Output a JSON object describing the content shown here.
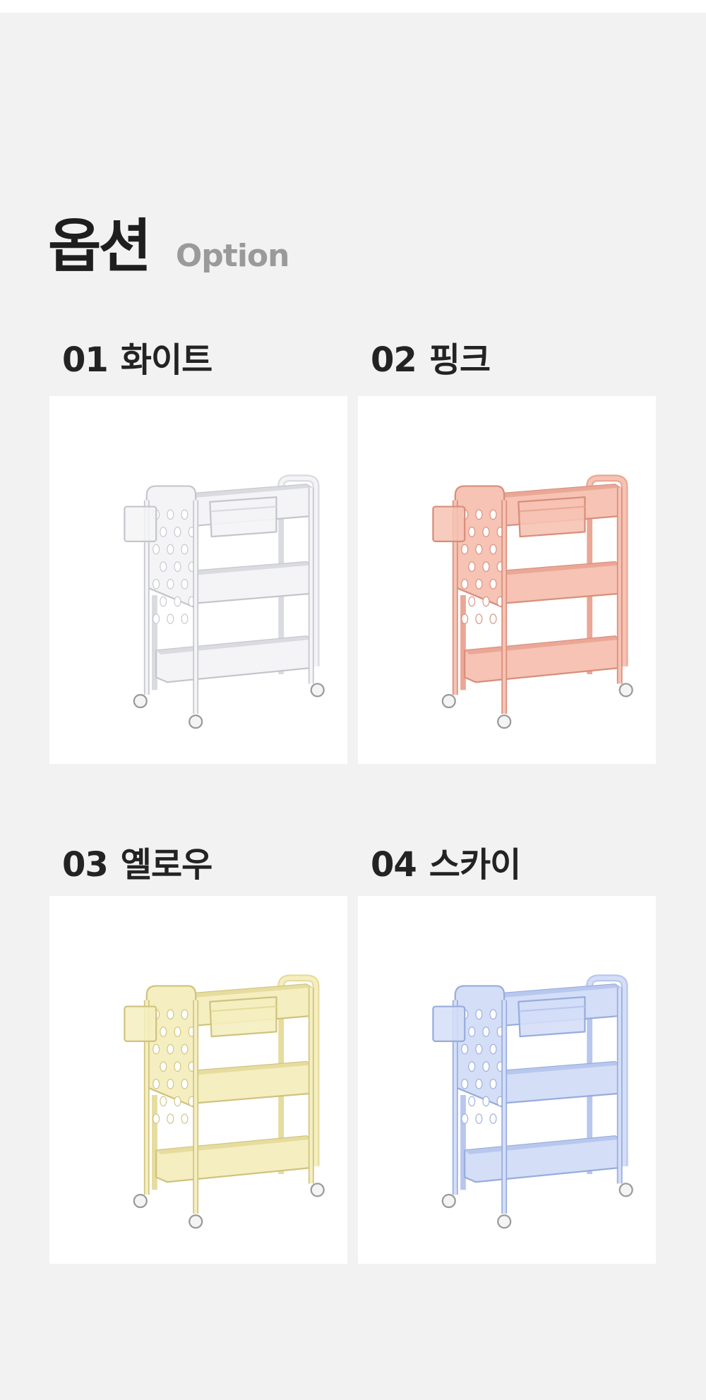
{
  "heading": {
    "title_ko": "옵션",
    "title_en": "Option"
  },
  "options": [
    {
      "number": "01",
      "name": "화이트",
      "icon": "cart-white",
      "colors": {
        "fill": "#f4f4f6",
        "shade": "#dadbe0",
        "edge": "#c4c6cc"
      }
    },
    {
      "number": "02",
      "name": "핑크",
      "icon": "cart-pink",
      "colors": {
        "fill": "#f6c3b4",
        "shade": "#eba796",
        "edge": "#d88e7c"
      }
    },
    {
      "number": "03",
      "name": "옐로우",
      "icon": "cart-yellow",
      "colors": {
        "fill": "#f5eec0",
        "shade": "#e6dc9e",
        "edge": "#cfc37e"
      }
    },
    {
      "number": "04",
      "name": "스카이",
      "icon": "cart-sky",
      "colors": {
        "fill": "#d4def7",
        "shade": "#b8c7ee",
        "edge": "#98acdc"
      }
    }
  ]
}
